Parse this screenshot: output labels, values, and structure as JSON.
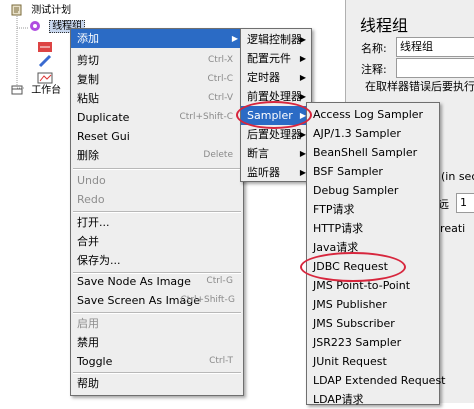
{
  "tree": {
    "items": [
      {
        "label": "测试计划"
      },
      {
        "label": "线程组"
      },
      {
        "label": "工作台"
      }
    ]
  },
  "right_panel": {
    "title": "线程组",
    "name_label": "名称:",
    "name_value": "线程组",
    "comment_label": "注释:",
    "error_action_text": "在取样器错误后要执行",
    "fragments": [
      "(in sec",
      "远",
      "1",
      "creati"
    ]
  },
  "context_menu": {
    "items": [
      {
        "label": "添加",
        "shortcut": "",
        "submenu": true,
        "highlighted": true,
        "disabled": false
      },
      {
        "label": "剪切",
        "shortcut": "Ctrl-X",
        "disabled": false
      },
      {
        "label": "复制",
        "shortcut": "Ctrl-C",
        "disabled": false
      },
      {
        "label": "粘贴",
        "shortcut": "Ctrl-V",
        "disabled": false
      },
      {
        "label": "Duplicate",
        "shortcut": "Ctrl+Shift-C",
        "disabled": false
      },
      {
        "label": "Reset Gui",
        "shortcut": "",
        "disabled": false
      },
      {
        "label": "删除",
        "shortcut": "Delete",
        "disabled": false
      },
      {
        "label": "Undo",
        "shortcut": "",
        "disabled": true
      },
      {
        "label": "Redo",
        "shortcut": "",
        "disabled": true
      },
      {
        "label": "打开...",
        "shortcut": "",
        "disabled": false
      },
      {
        "label": "合并",
        "shortcut": "",
        "disabled": false
      },
      {
        "label": "保存为...",
        "shortcut": "",
        "disabled": false
      },
      {
        "label": "Save Node As Image",
        "shortcut": "Ctrl-G",
        "disabled": false
      },
      {
        "label": "Save Screen As Image",
        "shortcut": "Ctrl+Shift-G",
        "disabled": false
      },
      {
        "label": "启用",
        "shortcut": "",
        "disabled": true
      },
      {
        "label": "禁用",
        "shortcut": "",
        "disabled": false
      },
      {
        "label": "Toggle",
        "shortcut": "Ctrl-T",
        "disabled": false
      },
      {
        "label": "帮助",
        "shortcut": "",
        "disabled": false
      }
    ]
  },
  "add_submenu": {
    "items": [
      {
        "label": "逻辑控制器",
        "submenu": true
      },
      {
        "label": "配置元件",
        "submenu": true
      },
      {
        "label": "定时器",
        "submenu": true
      },
      {
        "label": "前置处理器",
        "submenu": true
      },
      {
        "label": "Sampler",
        "submenu": true,
        "highlighted": true
      },
      {
        "label": "后置处理器",
        "submenu": true
      },
      {
        "label": "断言",
        "submenu": true
      },
      {
        "label": "监听器",
        "submenu": true
      }
    ]
  },
  "sampler_submenu": {
    "items": [
      {
        "label": "Access Log Sampler"
      },
      {
        "label": "AJP/1.3 Sampler"
      },
      {
        "label": "BeanShell Sampler"
      },
      {
        "label": "BSF Sampler"
      },
      {
        "label": "Debug Sampler"
      },
      {
        "label": "FTP请求"
      },
      {
        "label": "HTTP请求"
      },
      {
        "label": "Java请求"
      },
      {
        "label": "JDBC Request"
      },
      {
        "label": "JMS Point-to-Point"
      },
      {
        "label": "JMS Publisher"
      },
      {
        "label": "JMS Subscriber"
      },
      {
        "label": "JSR223 Sampler"
      },
      {
        "label": "JUnit Request"
      },
      {
        "label": "LDAP Extended Request"
      },
      {
        "label": "LDAP请求"
      }
    ]
  },
  "colors": {
    "highlight": "#2b6bc5",
    "annotation": "#d7263d",
    "menu_bg": "#eeeeee"
  }
}
